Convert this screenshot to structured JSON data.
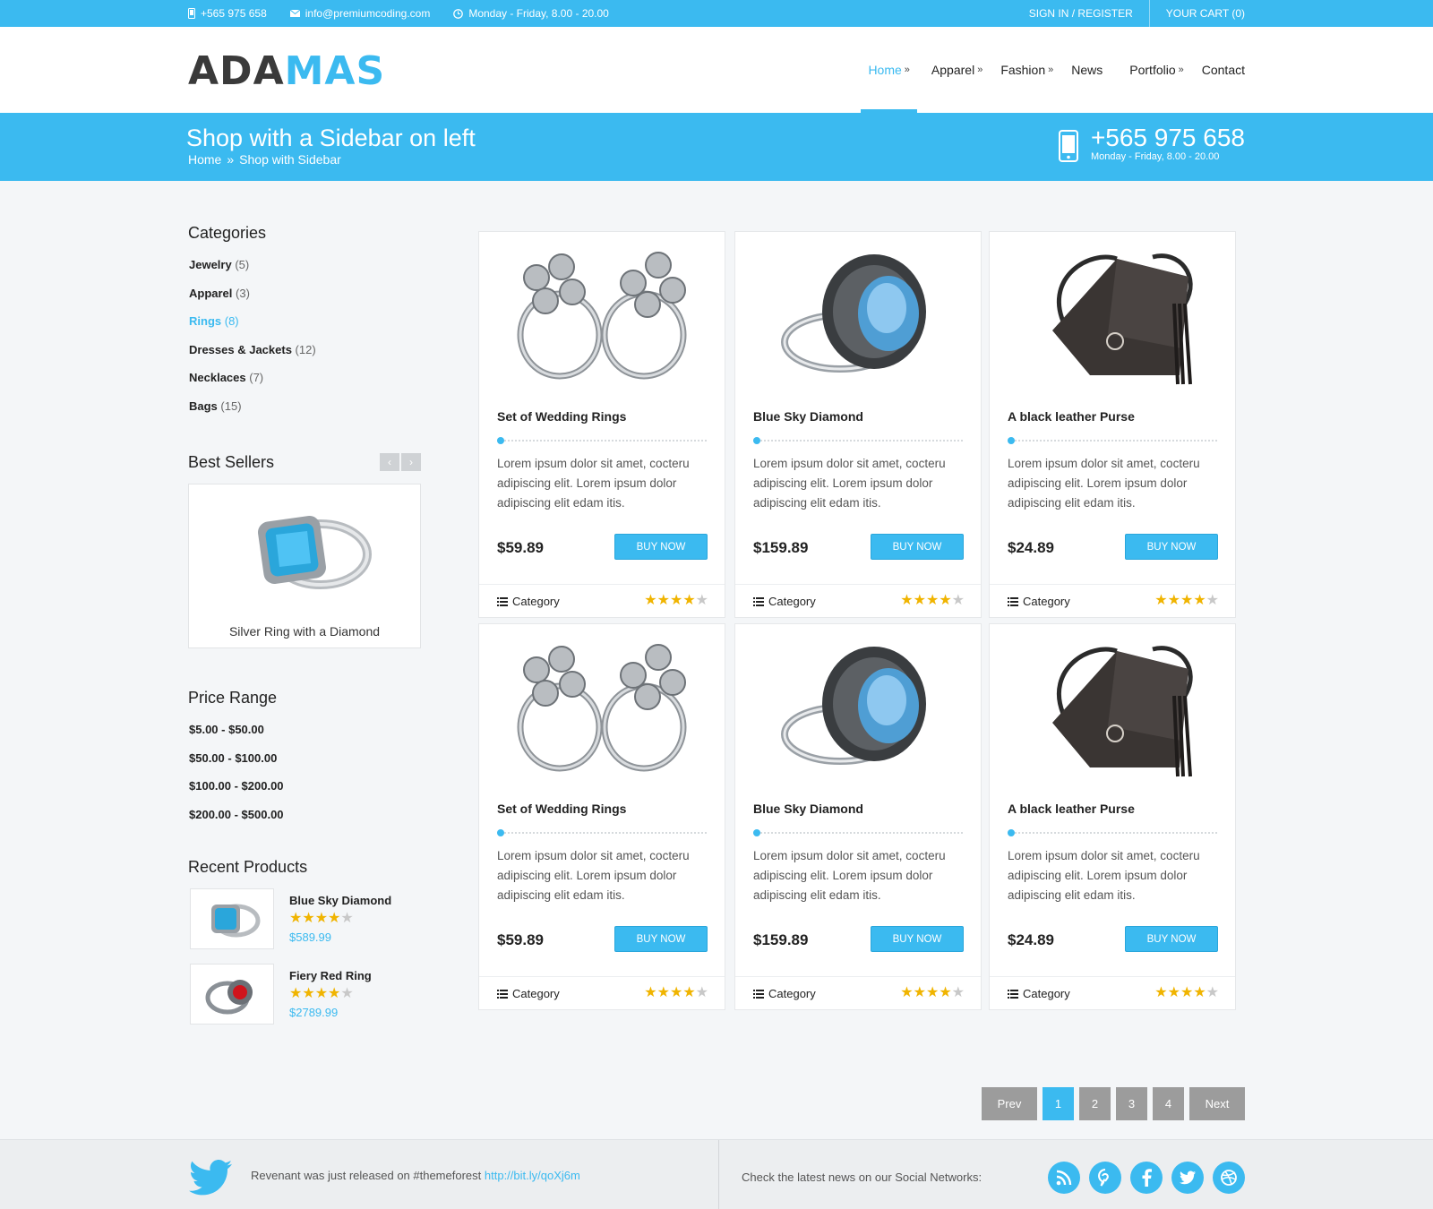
{
  "topbar": {
    "phone": "+565 975 658",
    "email": "info@premiumcoding.com",
    "hours": "Monday - Friday, 8.00 - 20.00",
    "sign_in": "SIGN IN / REGISTER",
    "cart": "YOUR CART (0)"
  },
  "logo": {
    "part1": "ADA",
    "part2": "MAS"
  },
  "nav": [
    {
      "label": "Home",
      "arrow": "»"
    },
    {
      "label": "Apparel",
      "arrow": "»"
    },
    {
      "label": "Fashion",
      "arrow": "»"
    },
    {
      "label": "News",
      "arrow": ""
    },
    {
      "label": "Portfolio",
      "arrow": "»"
    },
    {
      "label": "Contact",
      "arrow": ""
    }
  ],
  "band": {
    "title": "Shop with a Sidebar on left",
    "crumb_home": "Home",
    "crumb_sep": "»",
    "crumb_current": "Shop with Sidebar",
    "phone": "+565 975 658",
    "hours": "Monday - Friday, 8.00 - 20.00"
  },
  "sidebar": {
    "categories_title": "Categories",
    "categories": [
      {
        "name": "Jewelry",
        "count": "(5)"
      },
      {
        "name": "Apparel",
        "count": "(3)"
      },
      {
        "name": "Rings",
        "count": "(8)"
      },
      {
        "name": "Dresses & Jackets",
        "count": "(12)"
      },
      {
        "name": "Necklaces",
        "count": "(7)"
      },
      {
        "name": "Bags",
        "count": "(15)"
      }
    ],
    "best_sellers_title": "Best Sellers",
    "best_seller_name": "Silver Ring with a Diamond",
    "price_title": "Price Range",
    "prices": [
      "$5.00 - $50.00",
      "$50.00 - $100.00",
      "$100.00 - $200.00",
      "$200.00 - $500.00"
    ],
    "recent_title": "Recent Products",
    "recent": [
      {
        "name": "Blue Sky Diamond",
        "price": "$589.99",
        "rating": 4
      },
      {
        "name": "Fiery Red Ring",
        "price": "$2789.99",
        "rating": 4
      }
    ]
  },
  "products": [
    {
      "title": "Set of Wedding Rings",
      "desc": "Lorem ipsum dolor sit amet, cocteru adipiscing elit. Lorem ipsum dolor adipiscing elit edam itis.",
      "price": "$59.89",
      "buy": "BUY NOW",
      "category": "Category",
      "rating": 4,
      "image": "rings-icon"
    },
    {
      "title": "Blue Sky Diamond",
      "desc": "Lorem ipsum dolor sit amet, cocteru adipiscing elit. Lorem ipsum dolor adipiscing elit edam itis.",
      "price": "$159.89",
      "buy": "BUY NOW",
      "category": "Category",
      "rating": 4,
      "image": "blue-ring-icon"
    },
    {
      "title": "A black leather Purse",
      "desc": "Lorem ipsum dolor sit amet, cocteru adipiscing elit. Lorem ipsum dolor adipiscing elit edam itis.",
      "price": "$24.89",
      "buy": "BUY NOW",
      "category": "Category",
      "rating": 4,
      "image": "purse-icon"
    },
    {
      "title": "Set of Wedding Rings",
      "desc": "Lorem ipsum dolor sit amet, cocteru adipiscing elit. Lorem ipsum dolor adipiscing elit edam itis.",
      "price": "$59.89",
      "buy": "BUY NOW",
      "category": "Category",
      "rating": 4,
      "image": "rings-icon"
    },
    {
      "title": "Blue Sky Diamond",
      "desc": "Lorem ipsum dolor sit amet, cocteru adipiscing elit. Lorem ipsum dolor adipiscing elit edam itis.",
      "price": "$159.89",
      "buy": "BUY NOW",
      "category": "Category",
      "rating": 4,
      "image": "blue-ring-icon"
    },
    {
      "title": "A black leather Purse",
      "desc": "Lorem ipsum dolor sit amet, cocteru adipiscing elit. Lorem ipsum dolor adipiscing elit edam itis.",
      "price": "$24.89",
      "buy": "BUY NOW",
      "category": "Category",
      "rating": 4,
      "image": "purse-icon"
    }
  ],
  "pagination": {
    "prev": "Prev",
    "pages": [
      "1",
      "2",
      "3",
      "4"
    ],
    "current": "1",
    "next": "Next"
  },
  "footer": {
    "tweet_text": "Revenant was just released on #themeforest",
    "tweet_link": "http://bit.ly/qoXj6m",
    "social_text": "Check the latest news on our Social Networks:",
    "social_icons": [
      "rss-icon",
      "pinterest-icon",
      "facebook-icon",
      "twitter-icon",
      "dribbble-icon"
    ]
  },
  "colors": {
    "accent": "#3bbaf0",
    "star": "#f0b400",
    "pager": "#9c9c9c"
  }
}
